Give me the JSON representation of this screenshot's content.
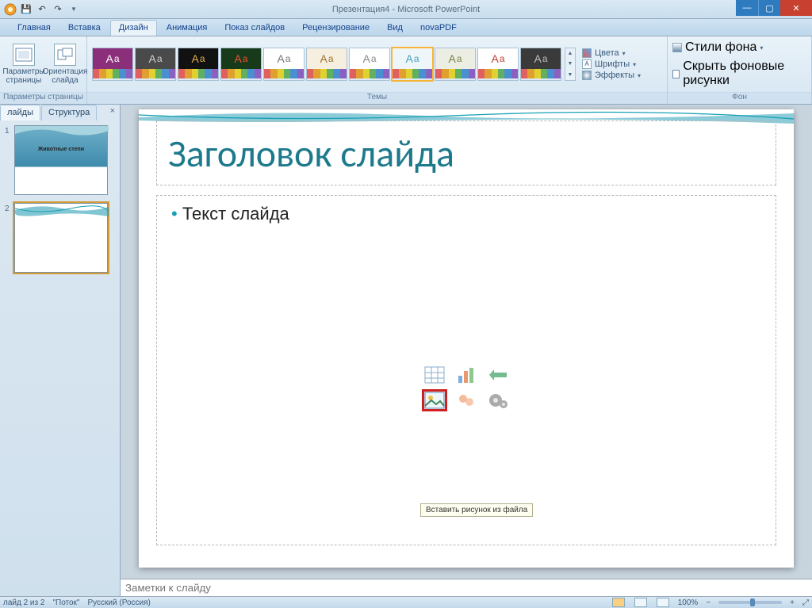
{
  "title": "Презентация4 - Microsoft PowerPoint",
  "qat": {
    "save": "💾",
    "undo": "↶",
    "redo": "↷"
  },
  "tabs": {
    "items": [
      "Главная",
      "Вставка",
      "Дизайн",
      "Анимация",
      "Показ слайдов",
      "Рецензирование",
      "Вид",
      "novaPDF"
    ],
    "active": 2
  },
  "ribbon": {
    "page_setup": {
      "params": "Параметры\nстраницы",
      "orient": "Ориентация\nслайда",
      "group": "Параметры страницы"
    },
    "themes": {
      "group": "Темы",
      "items": [
        {
          "bg": "#8c2f7a",
          "fg": "#ffffff"
        },
        {
          "bg": "#4a4a4a",
          "fg": "#d0d0d0"
        },
        {
          "bg": "#111111",
          "fg": "#e0b050"
        },
        {
          "bg": "#173a1a",
          "fg": "#f05030"
        },
        {
          "bg": "#ffffff",
          "fg": "#777777"
        },
        {
          "bg": "#f6efe0",
          "fg": "#a07030"
        },
        {
          "bg": "#ffffff",
          "fg": "#8a8a8a"
        },
        {
          "bg": "#eef6fa",
          "fg": "#4aa0c0",
          "sel": true
        },
        {
          "bg": "#eceee4",
          "fg": "#7a8040"
        },
        {
          "bg": "#ffffff",
          "fg": "#c04030"
        },
        {
          "bg": "#3a3a3a",
          "fg": "#bdbdbd"
        }
      ]
    },
    "right": {
      "colors": "Цвета",
      "fonts": "Шрифты",
      "effects": "Эффекты",
      "bgstyles": "Стили фона",
      "hidebg": "Скрыть фоновые рисунки",
      "bggroup": "Фон"
    }
  },
  "pane": {
    "tab_slides": "лайды",
    "tab_outline": "Структура",
    "thumbs": [
      {
        "title": "Животные степи"
      },
      {
        "title": ""
      }
    ],
    "selected": 1
  },
  "slide": {
    "title": "Заголовок слайда",
    "body": "Текст слайда",
    "tooltip": "Вставить рисунок из файла"
  },
  "notes": {
    "placeholder": "Заметки к слайду"
  },
  "status": {
    "slide": "лайд 2 из 2",
    "theme": "\"Поток\"",
    "lang": "Русский (Россия)",
    "zoom": "100%",
    "fit": "⤢"
  }
}
